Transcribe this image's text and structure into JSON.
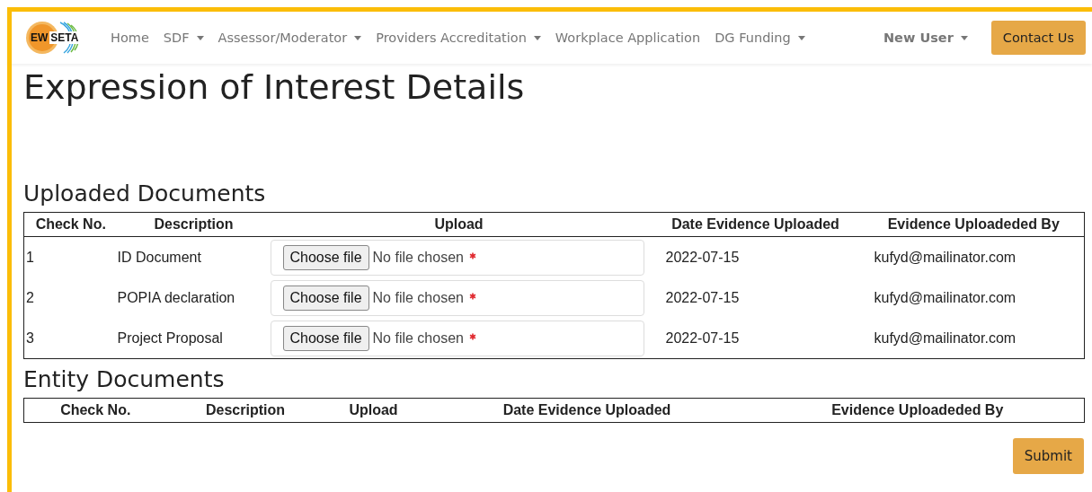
{
  "navbar": {
    "logo": {
      "left": "EW",
      "right": "SETA"
    },
    "items": [
      {
        "label": "Home",
        "dropdown": false
      },
      {
        "label": "SDF",
        "dropdown": true
      },
      {
        "label": "Assessor/Moderator",
        "dropdown": true
      },
      {
        "label": "Providers Accreditation",
        "dropdown": true
      },
      {
        "label": "Workplace Application",
        "dropdown": false
      },
      {
        "label": "DG Funding",
        "dropdown": true
      }
    ],
    "user": {
      "label": "New User",
      "dropdown": true
    },
    "contact_button": "Contact Us"
  },
  "title": "Expression of Interest Details",
  "uploaded_documents": {
    "heading": "Uploaded Documents",
    "columns": [
      "Check No.",
      "Description",
      "Upload",
      "Date Evidence Uploaded",
      "Evidence Uploadeded By"
    ],
    "rows": [
      {
        "check_no": "1",
        "description": "ID Document",
        "upload": {
          "button": "Choose file",
          "status": "No file chosen",
          "required": true
        },
        "date": "2022-07-15",
        "uploaded_by": "kufyd@mailinator.com"
      },
      {
        "check_no": "2",
        "description": "POPIA declaration",
        "upload": {
          "button": "Choose file",
          "status": "No file chosen",
          "required": true
        },
        "date": "2022-07-15",
        "uploaded_by": "kufyd@mailinator.com"
      },
      {
        "check_no": "3",
        "description": "Project Proposal",
        "upload": {
          "button": "Choose file",
          "status": "No file chosen",
          "required": true
        },
        "date": "2022-07-15",
        "uploaded_by": "kufyd@mailinator.com"
      }
    ]
  },
  "entity_documents": {
    "heading": "Entity Documents",
    "columns": [
      "Check No.",
      "Description",
      "Upload",
      "Date Evidence Uploaded",
      "Evidence Uploadeded By"
    ]
  },
  "submit_button": "Submit"
}
